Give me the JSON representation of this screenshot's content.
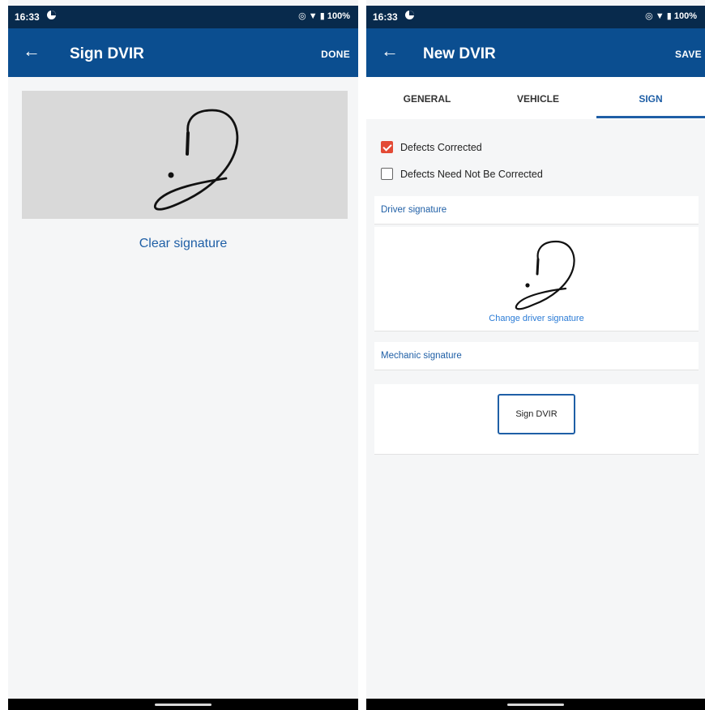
{
  "status_left": {
    "time": "16:33",
    "battery": "100%"
  },
  "status_right": {
    "time": "16:33",
    "battery": "100%"
  },
  "sign_screen": {
    "title": "Sign DVIR",
    "action": "DONE",
    "clear_signature": "Clear signature"
  },
  "new_dvir": {
    "title": "New DVIR",
    "action": "SAVE",
    "tabs": [
      {
        "label": "GENERAL",
        "active": false
      },
      {
        "label": "VEHICLE",
        "active": false
      },
      {
        "label": "SIGN",
        "active": true
      }
    ],
    "checks": [
      {
        "label": "Defects Corrected",
        "checked": true
      },
      {
        "label": "Defects Need Not Be Corrected",
        "checked": false
      }
    ],
    "driver_signature_header": "Driver signature",
    "change_driver_signature": "Change driver signature",
    "mechanic_signature_header": "Mechanic signature",
    "sign_button": "Sign DVIR"
  },
  "colors": {
    "status_bar": "#082a4c",
    "app_bar": "#0b4e90",
    "accent": "#1f5fa6",
    "check_red": "#e34a35"
  },
  "icons": [
    "back-arrow-icon",
    "sync-icon",
    "location-icon",
    "wifi-icon",
    "battery-icon"
  ]
}
